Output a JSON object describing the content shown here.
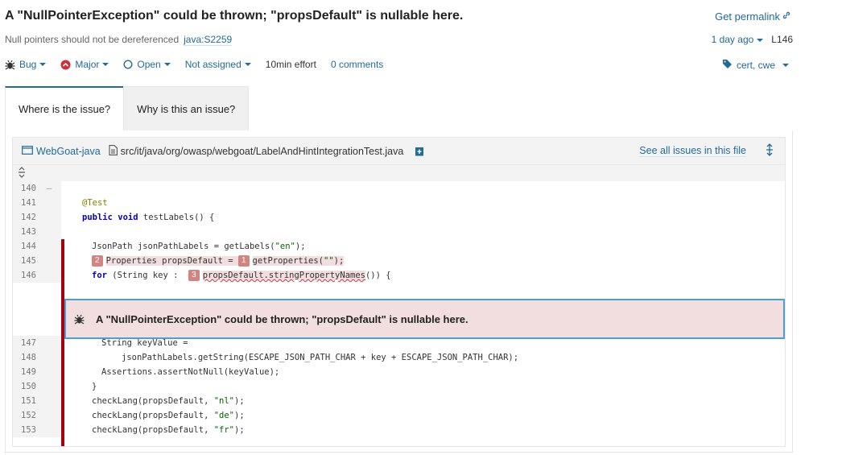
{
  "header": {
    "title": "A \"NullPointerException\" could be thrown; \"propsDefault\" is nullable here.",
    "permalink": "Get permalink",
    "rule_name": "Null pointers should not be dereferenced",
    "rule_key": "java:S2259",
    "age": "1 day ago",
    "line_ref": "L146"
  },
  "toolbar": {
    "type": "Bug",
    "severity": "Major",
    "status": "Open",
    "assignee": "Not assigned",
    "effort": "10min effort",
    "comments": "0 comments",
    "tags": "cert, cwe"
  },
  "tabs": [
    {
      "label": "Where is the issue?"
    },
    {
      "label": "Why is this an issue?"
    }
  ],
  "source": {
    "project": "WebGoat-java",
    "file_path": "src/it/java/org/owasp/webgoat/LabelAndHintIntegrationTest.java",
    "see_all": "See all issues in this file",
    "lines": [
      {
        "n": "140",
        "text": ""
      },
      {
        "n": "141",
        "text": "@Test"
      },
      {
        "n": "142",
        "text": "public void testLabels() {"
      },
      {
        "n": "143",
        "text": ""
      },
      {
        "n": "144",
        "text": "JsonPath jsonPathLabels = getLabels(\"en\");"
      },
      {
        "n": "145",
        "text": "Properties propsDefault = getProperties(\"\");"
      },
      {
        "n": "146",
        "text": "for (String key : propsDefault.stringPropertyNames()) {"
      },
      {
        "n": "147",
        "text": "String keyValue ="
      },
      {
        "n": "148",
        "text": "jsonPathLabels.getString(ESCAPE_JSON_PATH_CHAR + key + ESCAPE_JSON_PATH_CHAR);"
      },
      {
        "n": "149",
        "text": "Assertions.assertNotNull(keyValue);"
      },
      {
        "n": "150",
        "text": "}"
      },
      {
        "n": "151",
        "text": "checkLang(propsDefault, \"nl\");"
      },
      {
        "n": "152",
        "text": "checkLang(propsDefault, \"de\");"
      },
      {
        "n": "153",
        "text": "checkLang(propsDefault, \"fr\");"
      }
    ],
    "locations": [
      "1",
      "2",
      "3"
    ],
    "issue_message": "A \"NullPointerException\" could be thrown; \"propsDefault\" is nullable here."
  }
}
